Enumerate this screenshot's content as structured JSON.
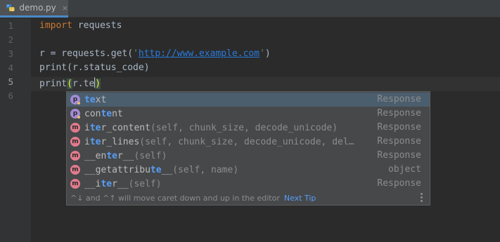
{
  "tab": {
    "filename": "demo.py",
    "close_glyph": "×",
    "icon": "python-file-icon"
  },
  "gutter": {
    "lines": [
      "1",
      "2",
      "3",
      "4",
      "5",
      "6"
    ],
    "current_line": "5"
  },
  "code": {
    "line1": {
      "kw": "import",
      "rest": " requests"
    },
    "line3": {
      "pre": "r = requests.get(",
      "q1": "'",
      "url": "http://www.example.com",
      "q2": "'",
      "post": ")"
    },
    "line4": "print(r.status_code)",
    "line5": {
      "pre": "print",
      "open_paren": "(",
      "typed": "r.te",
      "close_paren": ")"
    }
  },
  "completion": {
    "items": [
      {
        "badge": "p",
        "kind": "property",
        "before": "",
        "match": "te",
        "after": "xt",
        "sig": "",
        "type": "Response",
        "selected": true
      },
      {
        "badge": "p",
        "kind": "property",
        "before": "con",
        "match": "te",
        "after": "nt",
        "sig": "",
        "type": "Response",
        "selected": false
      },
      {
        "badge": "m",
        "kind": "method",
        "before": "i",
        "match": "te",
        "after": "r_content",
        "sig": "(self, chunk_size, decode_unicode)",
        "type": "Response",
        "selected": false
      },
      {
        "badge": "m",
        "kind": "method",
        "before": "i",
        "match": "te",
        "after": "r_lines",
        "sig": "(self, chunk_size, decode_unicode, del…",
        "type": "Response",
        "selected": false
      },
      {
        "badge": "m",
        "kind": "method",
        "before": "__en",
        "match": "te",
        "after": "r__",
        "sig": "(self)",
        "type": "Response",
        "selected": false
      },
      {
        "badge": "m",
        "kind": "method",
        "before": "__getattribu",
        "match": "te",
        "after": "__",
        "sig": "(self, name)",
        "type": "object",
        "selected": false
      },
      {
        "badge": "m",
        "kind": "method",
        "before": "__i",
        "match": "te",
        "after": "r__",
        "sig": "(self)",
        "type": "Response",
        "selected": false
      }
    ],
    "footer": {
      "hint": "^↓ and ^↑ will move caret down and up in the editor",
      "next_tip": "Next Tip"
    }
  },
  "colors": {
    "editor_bg": "#2b2b2b",
    "keyword": "#cc7832",
    "string": "#6a8759",
    "match": "#589df6",
    "method_badge": "#e27b8c",
    "property_badge": "#a38bd4"
  }
}
